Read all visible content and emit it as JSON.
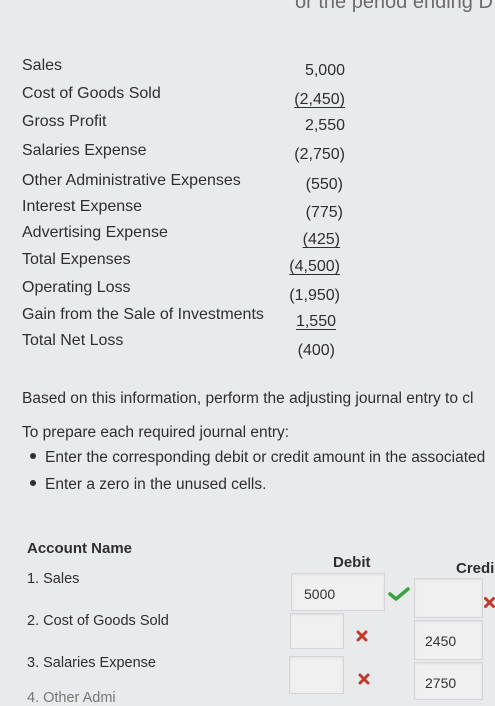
{
  "top_fragment": "or the period ending D",
  "statement": [
    {
      "label": "Sales",
      "value": "5,000",
      "underline": false
    },
    {
      "label": "Cost of Goods Sold",
      "value": "(2,450)",
      "underline": true
    },
    {
      "label": "Gross Profit",
      "value": "2,550",
      "underline": false
    },
    {
      "label": "Salaries Expense",
      "value": "(2,750)",
      "underline": false
    },
    {
      "label": "Other Administrative Expenses",
      "value": "(550)",
      "underline": false
    },
    {
      "label": "Interest Expense",
      "value": "(775)",
      "underline": false
    },
    {
      "label": "Advertising Expense",
      "value": "(425)",
      "underline": true
    },
    {
      "label": "Total Expenses",
      "value": "(4,500)",
      "underline": true
    },
    {
      "label": "Operating Loss",
      "value": "(1,950)",
      "underline": false
    },
    {
      "label": "Gain from the Sale of Investments",
      "value": "1,550",
      "underline": true
    },
    {
      "label": "Total Net Loss",
      "value": "(400)",
      "underline": false
    }
  ],
  "instructions": {
    "line1": "Based on this information, perform the adjusting journal entry to cl",
    "line2": "To prepare each required journal entry:",
    "bullet1": "Enter the corresponding debit or credit amount in the associated",
    "bullet2": "Enter a zero in the unused cells."
  },
  "table": {
    "account_header": "Account Name",
    "debit_header": "Debit",
    "credit_header": "Credi",
    "rows": [
      {
        "account": "1. Sales",
        "debit": "5000",
        "debit_mark": "check",
        "credit": "",
        "credit_mark": "cross"
      },
      {
        "account": "2. Cost of Goods Sold",
        "debit": "",
        "debit_mark": "cross",
        "credit": "2450",
        "credit_mark": ""
      },
      {
        "account": "3. Salaries Expense",
        "debit": "",
        "debit_mark": "cross",
        "credit": "2750",
        "credit_mark": ""
      },
      {
        "account": "4. Other Admi",
        "debit": "",
        "debit_mark": "",
        "credit": "",
        "credit_mark": ""
      }
    ]
  },
  "colors": {
    "check": "#3aa23a",
    "cross": "#c0392b"
  }
}
